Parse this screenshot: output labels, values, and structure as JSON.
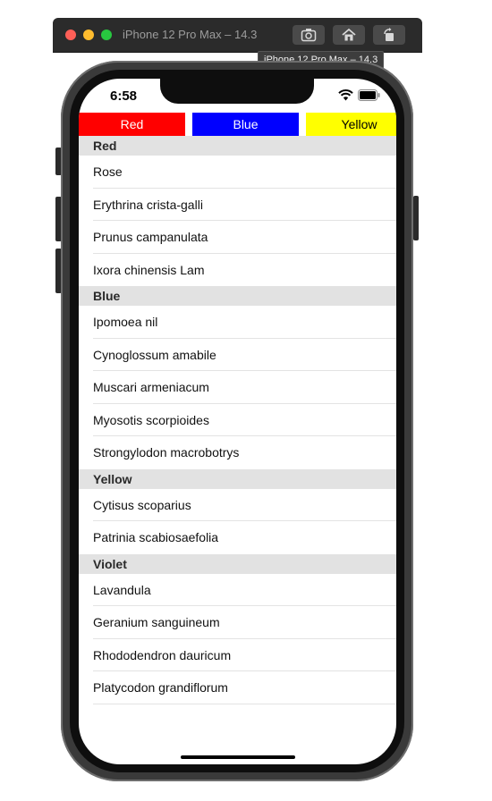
{
  "window": {
    "title": "iPhone 12 Pro Max – 14.3",
    "tooltip": "iPhone 12 Pro Max – 14.3",
    "buttons": [
      {
        "icon": "screenshot-icon"
      },
      {
        "icon": "home-icon"
      },
      {
        "icon": "rotate-icon"
      }
    ]
  },
  "status_bar": {
    "time": "6:58",
    "icons": [
      "wifi-icon",
      "battery-icon"
    ]
  },
  "color_buttons": [
    {
      "label": "Red",
      "color": "#ff0000"
    },
    {
      "label": "Blue",
      "color": "#0000ff"
    },
    {
      "label": "Yellow",
      "color": "#ffff00"
    }
  ],
  "sections": [
    {
      "title": "Red",
      "items": [
        "Rose",
        "Erythrina crista-galli",
        "Prunus campanulata",
        "Ixora chinensis Lam"
      ]
    },
    {
      "title": "Blue",
      "items": [
        "Ipomoea nil",
        "Cynoglossum amabile",
        "Muscari armeniacum",
        "Myosotis scorpioides",
        "Strongylodon macrobotrys"
      ]
    },
    {
      "title": "Yellow",
      "items": [
        "Cytisus scoparius",
        "Patrinia scabiosaefolia"
      ]
    },
    {
      "title": "Violet",
      "items": [
        "Lavandula",
        "Geranium sanguineum",
        "Rhododendron dauricum",
        "Platycodon grandiflorum"
      ]
    }
  ]
}
